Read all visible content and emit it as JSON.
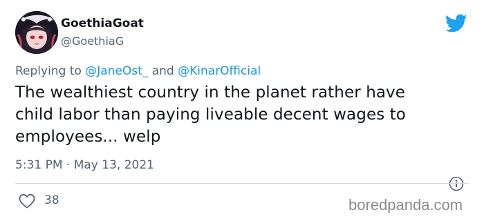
{
  "tweet": {
    "author": {
      "display_name": "GoethiaGoat",
      "handle": "@GoethiaG",
      "avatar_icon": "anime-character-avatar"
    },
    "platform_icon": "twitter-bird-icon",
    "replying_to": {
      "prefix": "Replying to",
      "mention_1": "@JaneOst_",
      "conjunction": "and",
      "mention_2": "@KinarOfficial"
    },
    "text_lines": [
      "The wealthiest country in the planet rather have",
      "child labor than paying liveable decent wages to",
      "employees... welp"
    ],
    "timestamp": "5:31 PM · May 13, 2021",
    "likes_count": "38"
  },
  "watermark": "boredpanda.com",
  "colors": {
    "text": "#0f1419",
    "muted": "#536471",
    "mention": "#1b95e0",
    "twitter_blue": "#1da1f2",
    "divider": "#cfd9de"
  }
}
